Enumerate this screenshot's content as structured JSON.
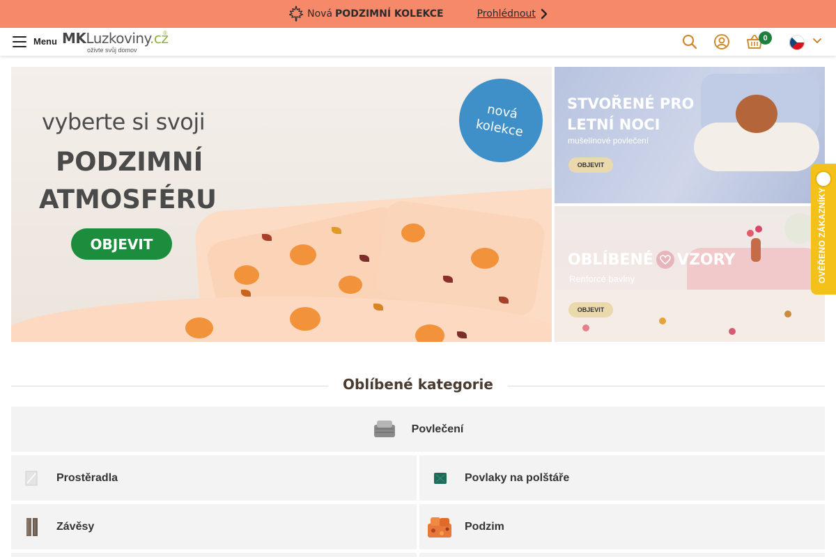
{
  "announcement": {
    "prefix": "Nová",
    "highlight": "PODZIMNÍ KOLEKCE",
    "link_label": "Prohlédnout"
  },
  "header": {
    "menu_label": "Menu",
    "logo": {
      "brand_bold": "MK",
      "brand_rest": "Luzkoviny",
      "brand_tld": ".cz",
      "registered": "®",
      "tagline": "oživte svůj domov"
    },
    "cart_count": "0",
    "language": "CZ"
  },
  "banners": {
    "main": {
      "line1": "vyberte si svoji",
      "line2": "PODZIMNÍ",
      "line3": "ATMOSFÉRU",
      "cta": "OBJEVIT",
      "sticker_line1": "nová",
      "sticker_line2": "kolekce"
    },
    "summer": {
      "line1": "STVOŘENÉ PRO",
      "line2": "LETNÍ NOCI",
      "subtitle": "mušelínové povlečení",
      "cta": "OBJEVIT"
    },
    "patterns": {
      "title_left": "OBLÍBENÉ",
      "title_right": "VZORY",
      "subtitle": "Renforcé bavlny",
      "cta": "OBJEVIT"
    }
  },
  "verified_tab": {
    "label": "OVĚŘENO ZÁKAZNÍKY"
  },
  "categories_section": {
    "title": "Oblíbené kategorie",
    "items": [
      {
        "label": "Povlečení",
        "icon": "bedding-thumb"
      },
      {
        "label": "Prostěradla",
        "icon": "sheet-thumb"
      },
      {
        "label": "Povlaky na polštáře",
        "icon": "pillowcase-thumb"
      },
      {
        "label": "Závěsy",
        "icon": "curtain-thumb"
      },
      {
        "label": "Podzim",
        "icon": "autumn-thumb"
      }
    ]
  },
  "colors": {
    "topbar": "#f5896a",
    "cta_green": "#1c8d3d",
    "badge_green": "#1d7f3c",
    "sticker_blue": "#3f90c9",
    "verified_yellow": "#f4c11a"
  }
}
